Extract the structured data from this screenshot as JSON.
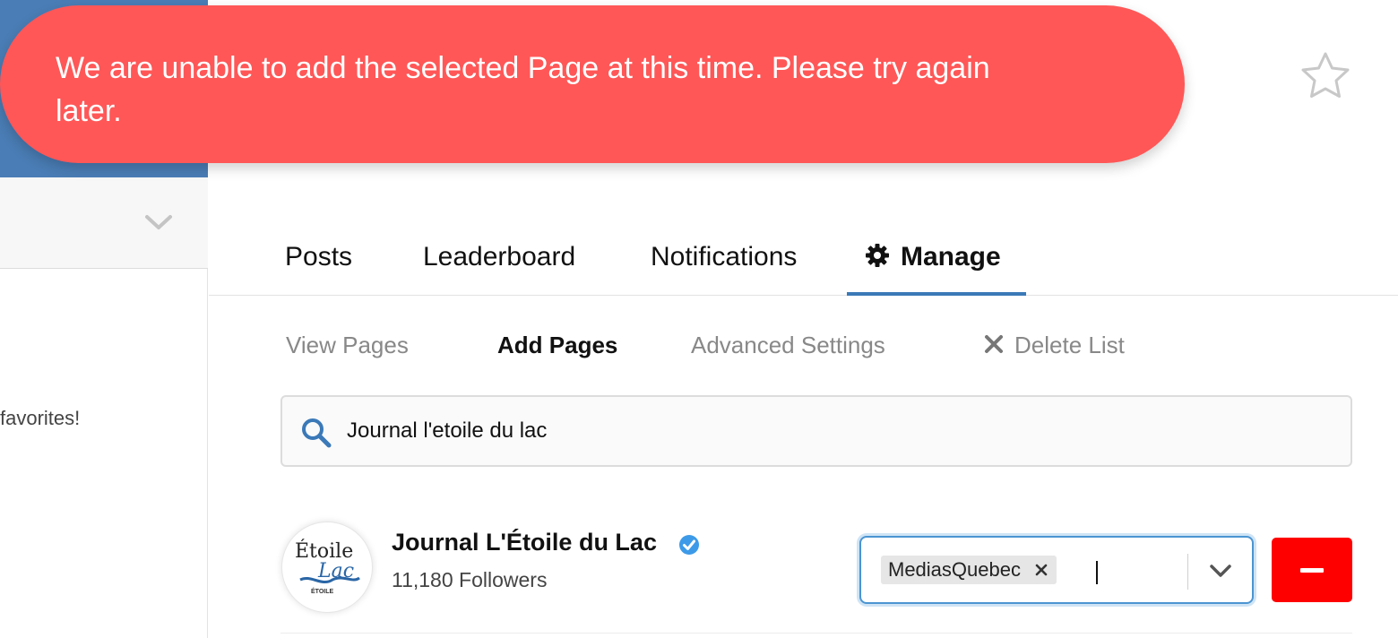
{
  "toast": {
    "message": "We are unable to add the selected Page at this time. Please try again later.",
    "color": "#ff5757"
  },
  "left_panel": {
    "header_color": "#4a7db5",
    "partial_text": "favorites!"
  },
  "tabs": [
    {
      "label": "Posts"
    },
    {
      "label": "Leaderboard"
    },
    {
      "label": "Notifications"
    },
    {
      "label": "Manage",
      "icon": "gear-icon",
      "active": true
    }
  ],
  "subtabs": [
    {
      "label": "View Pages"
    },
    {
      "label": "Add Pages",
      "active": true
    },
    {
      "label": "Advanced Settings"
    },
    {
      "label": "Delete List",
      "icon": "close-icon"
    }
  ],
  "search": {
    "value": "Journal l'etoile du lac",
    "icon": "search-icon"
  },
  "result": {
    "name": "Journal L'Étoile du Lac",
    "verified": true,
    "followers": "11,180 Followers",
    "avatar_text_top": "Étoile",
    "avatar_text_bottom": "Lac",
    "avatar_text_small": "ÉTOILE",
    "selected_lists": [
      "MediasQuebec"
    ]
  },
  "colors": {
    "accent": "#3b79b8",
    "remove_button": "#ff0000",
    "verified_badge": "#3d9ae8"
  }
}
